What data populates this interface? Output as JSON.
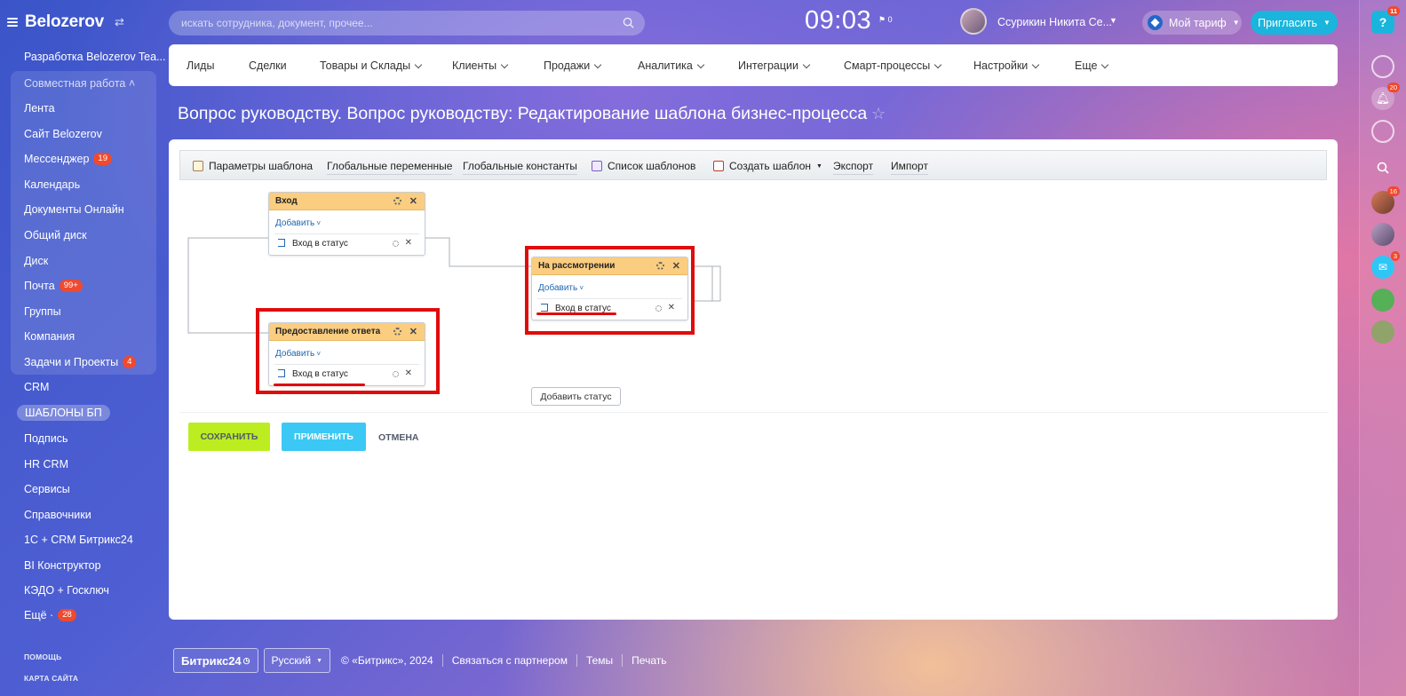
{
  "sidebar": {
    "logo": "Belozerov",
    "items": [
      {
        "label": "Разработка Belozerov Tea..."
      },
      {
        "label": "Совместная работа ˄"
      },
      {
        "label": "Лента"
      },
      {
        "label": "Сайт Belozerov"
      },
      {
        "label": "Мессенджер",
        "badge": "19"
      },
      {
        "label": "Календарь"
      },
      {
        "label": "Документы Онлайн"
      },
      {
        "label": "Общий диск"
      },
      {
        "label": "Диск"
      },
      {
        "label": "Почта",
        "badge": "99+"
      },
      {
        "label": "Группы"
      },
      {
        "label": "Компания"
      },
      {
        "label": "Задачи и Проекты",
        "badge": "4"
      },
      {
        "label": "CRM"
      },
      {
        "label": "ШАБЛОНЫ БП"
      },
      {
        "label": "Подпись"
      },
      {
        "label": "HR CRM"
      },
      {
        "label": "Сервисы"
      },
      {
        "label": "Справочники"
      },
      {
        "label": "1С + CRM Битрикс24"
      },
      {
        "label": "BI Конструктор"
      },
      {
        "label": "КЭДО + Госключ"
      },
      {
        "label": "Ещё ·",
        "badge": "28"
      }
    ],
    "help": "ПОМОЩЬ",
    "sitemap": "КАРТА САЙТА"
  },
  "topbar": {
    "search_placeholder": "искать сотрудника, документ, прочее...",
    "time": "09:03",
    "flag_count": "0",
    "user_name": "Ссурикин Никита Се...",
    "tariff": "Мой тариф",
    "invite": "Пригласить"
  },
  "rightbar": {
    "help_badge": "11",
    "bell_badge": "20",
    "user1_badge": "16",
    "chat_badge": "3"
  },
  "menu": {
    "items": [
      "Лиды",
      "Сделки",
      "Товары и Склады",
      "Клиенты",
      "Продажи",
      "Аналитика",
      "Интеграции",
      "Смарт-процессы",
      "Настройки",
      "Еще"
    ]
  },
  "page": {
    "title": "Вопрос руководству. Вопрос руководству: Редактирование шаблона бизнес-процесса"
  },
  "toolbar": {
    "params": "Параметры шаблона",
    "global_vars": "Глобальные переменные",
    "global_consts": "Глобальные константы",
    "templates_list": "Список шаблонов",
    "create_template": "Создать шаблон",
    "export": "Экспорт",
    "import": "Импорт"
  },
  "states": [
    {
      "title": "Вход",
      "add": "Добавить",
      "action": "Вход в статус"
    },
    {
      "title": "На рассмотрении",
      "add": "Добавить",
      "action": "Вход в статус"
    },
    {
      "title": "Предоставление ответа",
      "add": "Добавить",
      "action": "Вход в статус"
    }
  ],
  "actions": {
    "add_status": "Добавить статус",
    "save": "СОХРАНИТЬ",
    "apply": "ПРИМЕНИТЬ",
    "cancel": "ОТМЕНА"
  },
  "footer": {
    "logo": "Битрикс24",
    "lang": "Русский",
    "copyright": "© «Битрикс», 2024",
    "partner": "Связаться с партнером",
    "themes": "Темы",
    "print": "Печать"
  },
  "colors": {
    "save": "#bbed21",
    "apply": "#3bc8f5",
    "state_header": "#fbcd80",
    "highlight": "#e00b0b",
    "badge": "#f0492d"
  }
}
